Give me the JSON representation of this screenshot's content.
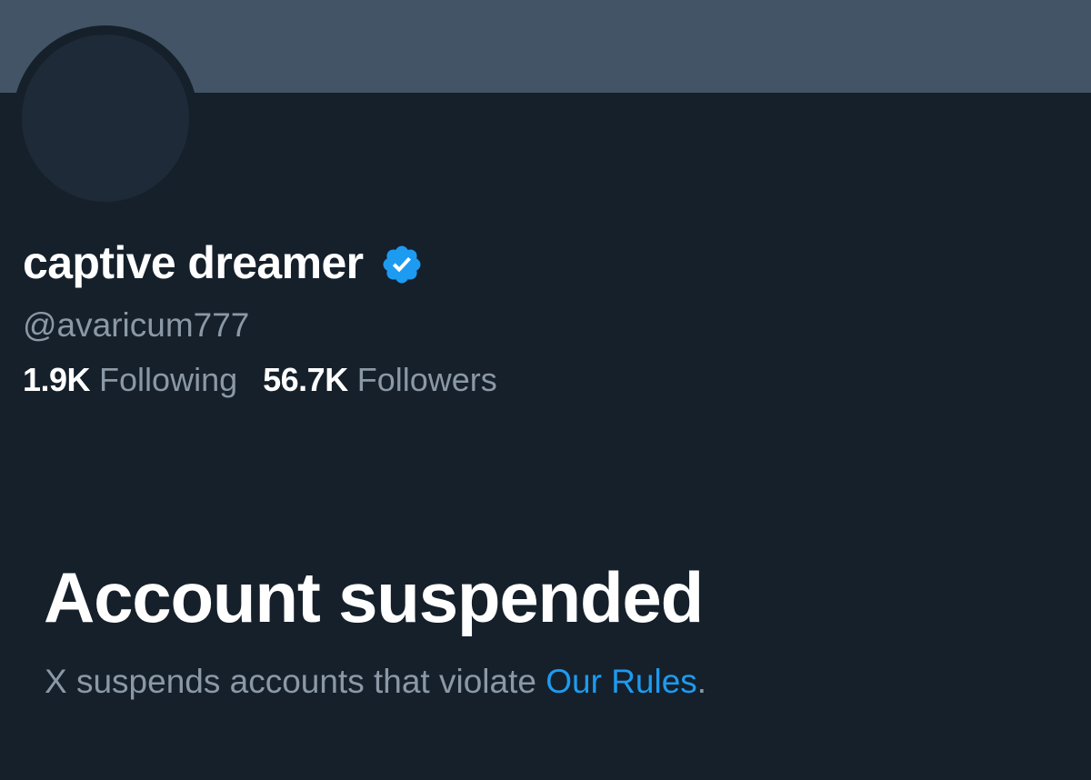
{
  "profile": {
    "display_name": "captive dreamer",
    "handle": "@avaricum777",
    "verified_icon": "verified-badge-icon",
    "following": {
      "count": "1.9K",
      "label": "Following"
    },
    "followers": {
      "count": "56.7K",
      "label": "Followers"
    }
  },
  "suspension": {
    "title": "Account suspended",
    "message_prefix": "X suspends accounts that violate ",
    "link_text": "Our Rules",
    "message_suffix": "."
  },
  "colors": {
    "background": "#15202b",
    "banner": "#425466",
    "accent": "#1d9bf0",
    "muted_text": "#8b98a5"
  }
}
